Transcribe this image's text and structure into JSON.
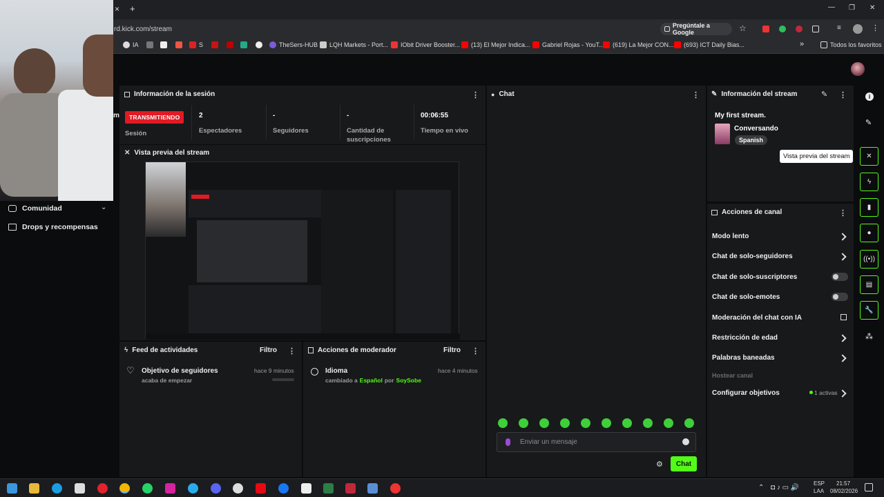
{
  "browser": {
    "tab_add": "+",
    "tab_close": "×",
    "url": "rd.kick.com/stream",
    "ask_google": "Pregúntale a Google",
    "window_controls": [
      "—",
      "❐",
      "✕"
    ],
    "bookmarks": [
      {
        "label": "IA"
      },
      {
        "label": "S"
      },
      {
        "label": "TheSers-HUB"
      },
      {
        "label": "LQH Markets - Port..."
      },
      {
        "label": "IObit Driver Booster..."
      },
      {
        "label": "(13) El Mejor Indica..."
      },
      {
        "label": "Gabriel Rojas - YouT..."
      },
      {
        "label": "(619) La Mejor CON..."
      },
      {
        "label": "(693) ICT Daily Bias..."
      }
    ],
    "bookmarks_more": "»",
    "all_favorites": "Todos los favoritos"
  },
  "sidebar": {
    "items": [
      {
        "label": "Comunidad"
      },
      {
        "label": "Drops y recompensas"
      }
    ],
    "partial_letter": "m"
  },
  "session": {
    "title": "Información de la sesión",
    "live_badge": "TRANSMITIENDO",
    "session_label": "Sesión",
    "stats": [
      {
        "value": "2",
        "label": "Espectadores"
      },
      {
        "value": "-",
        "label": "Seguidores"
      },
      {
        "value": "-",
        "label": "Cantidad de suscripciones"
      },
      {
        "value": "00:06:55",
        "label": "Tiempo en vivo"
      }
    ]
  },
  "preview": {
    "title": "Vista previa del stream"
  },
  "activity": {
    "title": "Feed de actividades",
    "filter": "Filtro",
    "items": [
      {
        "title": "Objetivo de seguidores",
        "subtitle": "acaba de empezar",
        "time": "hace 9 minutos"
      }
    ]
  },
  "moderator": {
    "title": "Acciones de moderador",
    "filter": "Filtro",
    "items": [
      {
        "title": "Idioma",
        "prefix": "cambiado a",
        "value": "Español",
        "by": "por",
        "user": "SoySobe",
        "time": "hace 4 minutos"
      }
    ]
  },
  "chat": {
    "title": "Chat",
    "input_placeholder": "Enviar un mensaje",
    "send_label": "Chat",
    "emote_count": 10,
    "colors": {
      "accent": "#53fc18"
    }
  },
  "stream_info": {
    "title": "Información del stream",
    "stream_title": "My first stream.",
    "category": "Conversando",
    "language": "Spanish"
  },
  "tooltip": "Vista previa del stream",
  "channel_actions": {
    "title": "Acciones de canal",
    "rows": [
      {
        "label": "Modo lento",
        "control": "chevron"
      },
      {
        "label": "Chat de solo-seguidores",
        "control": "chevron"
      },
      {
        "label": "Chat de solo-suscriptores",
        "control": "toggle"
      },
      {
        "label": "Chat de solo-emotes",
        "control": "toggle"
      },
      {
        "label": "Moderación del chat con IA",
        "control": "external"
      },
      {
        "label": "Restricción de edad",
        "control": "chevron"
      },
      {
        "label": "Palabras baneadas",
        "control": "chevron"
      },
      {
        "label": "Hostear canal",
        "control": "none"
      },
      {
        "label": "Configurar objetivos",
        "control": "chevron"
      }
    ],
    "goals_active": "1 activas"
  },
  "taskbar": {
    "lang": "ESP",
    "region": "LAA",
    "time": "21:57",
    "date": "08/02/2026"
  }
}
